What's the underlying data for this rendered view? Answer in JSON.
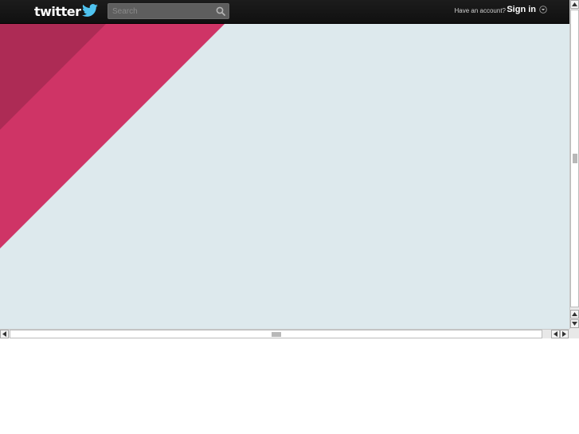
{
  "header": {
    "logo_text": "twitter",
    "logo_icon": "bird-icon",
    "search": {
      "placeholder": "Search",
      "value": "",
      "icon": "magnifier-icon"
    },
    "account_prompt": "Have an account?",
    "signin_label": "Sign in",
    "signin_icon": "caret-down-circle-icon"
  },
  "colors": {
    "topbar": "#141414",
    "background": "#dde9ed",
    "stripe_light": "#cf3466",
    "stripe_dark": "#ad2b55",
    "white": "#ffffff"
  },
  "scrollbars": {
    "vertical": {
      "up_icon": "arrow-up-icon",
      "down_icon": "arrow-down-icon"
    },
    "horizontal": {
      "left_icon": "arrow-left-icon",
      "right_icon": "arrow-right-icon"
    }
  }
}
